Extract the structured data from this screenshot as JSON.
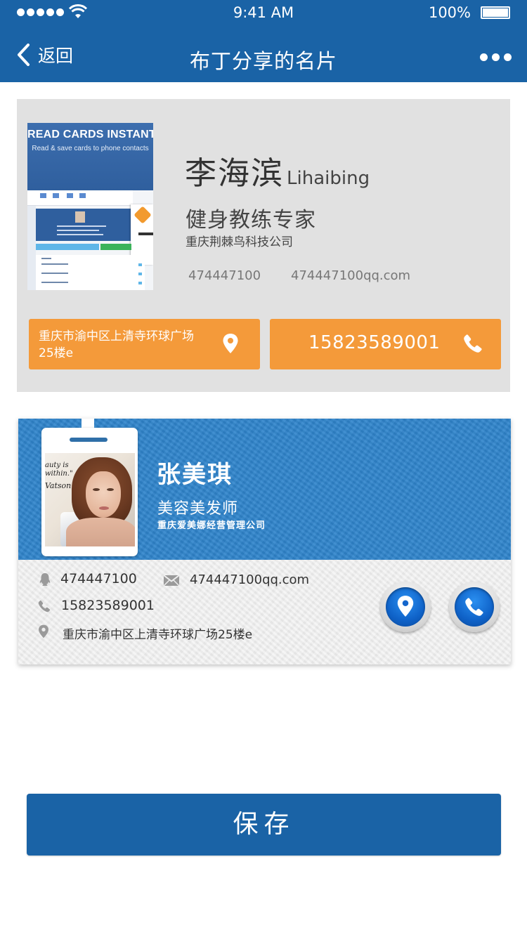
{
  "status_bar": {
    "time": "9:41 AM",
    "battery": "100%"
  },
  "nav": {
    "back_label": "返回",
    "title": "布丁分享的名片"
  },
  "card1": {
    "thumbnail": {
      "headline": "READ CARDS INSTANTLY",
      "subline": "Read & save cards to phone contacts"
    },
    "name_cn": "李海滨",
    "name_en": "Lihaibing",
    "title": "健身教练专家",
    "company": "重庆荆棘鸟科技公司",
    "qq": "474447100",
    "email": "474447100qq.com",
    "address": "重庆市渝中区上清寺环球广场25楼e",
    "phone": "15823589001",
    "accent": "#f49a3a"
  },
  "card2": {
    "photo_text_a": "auty is\nwithin.\"",
    "photo_text_b": "Vatson",
    "name": "张美琪",
    "title": "美容美发师",
    "company": "重庆爱美娜经营管理公司",
    "qq": "474447100",
    "email": "474447100qq.com",
    "phone": "15823589001",
    "address": "重庆市渝中区上清寺环球广场25楼e",
    "accent": "#2f84cb"
  },
  "icons": {
    "back": "chevron-left-icon",
    "more": "more-dots-icon",
    "location": "map-pin-icon",
    "phone": "phone-icon",
    "qq": "qq-icon",
    "mail": "mail-icon"
  },
  "save_label": "保存",
  "theme": {
    "primary": "#1a63a6"
  }
}
